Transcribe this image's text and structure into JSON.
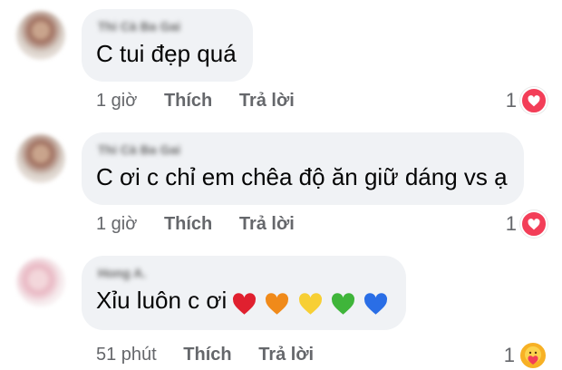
{
  "comments": [
    {
      "author": "Thi Cà Ba Gai",
      "text": "C tui đẹp quá",
      "time": "1 giờ",
      "like_label": "Thích",
      "reply_label": "Trả lời",
      "reaction_count": "1",
      "reaction_icon": "love-reaction-icon"
    },
    {
      "author": "Thi Cà Ba Gai",
      "text": "C ơi c chỉ em chêa độ ăn giữ dáng vs ạ",
      "time": "1 giờ",
      "like_label": "Thích",
      "reply_label": "Trả lời",
      "reaction_count": "1",
      "reaction_icon": "love-reaction-icon"
    },
    {
      "author": "Hong A.",
      "text": "Xỉu luôn c ơi",
      "emoji_hearts": [
        "red",
        "orange",
        "yellow",
        "green",
        "blue"
      ],
      "time": "51 phút",
      "like_label": "Thích",
      "reply_label": "Trả lời",
      "reaction_count": "1",
      "reaction_icon": "care-reaction-icon"
    }
  ],
  "colors": {
    "bubble_bg": "#f0f2f5",
    "meta_text": "#65676b",
    "love_red": "#f33e58",
    "care_yellow": "#f7b125",
    "heart_red": "#e0202f",
    "heart_orange": "#f08a1a",
    "heart_yellow": "#f7cf34",
    "heart_green": "#3fb53a",
    "heart_blue": "#2a6ee6"
  }
}
